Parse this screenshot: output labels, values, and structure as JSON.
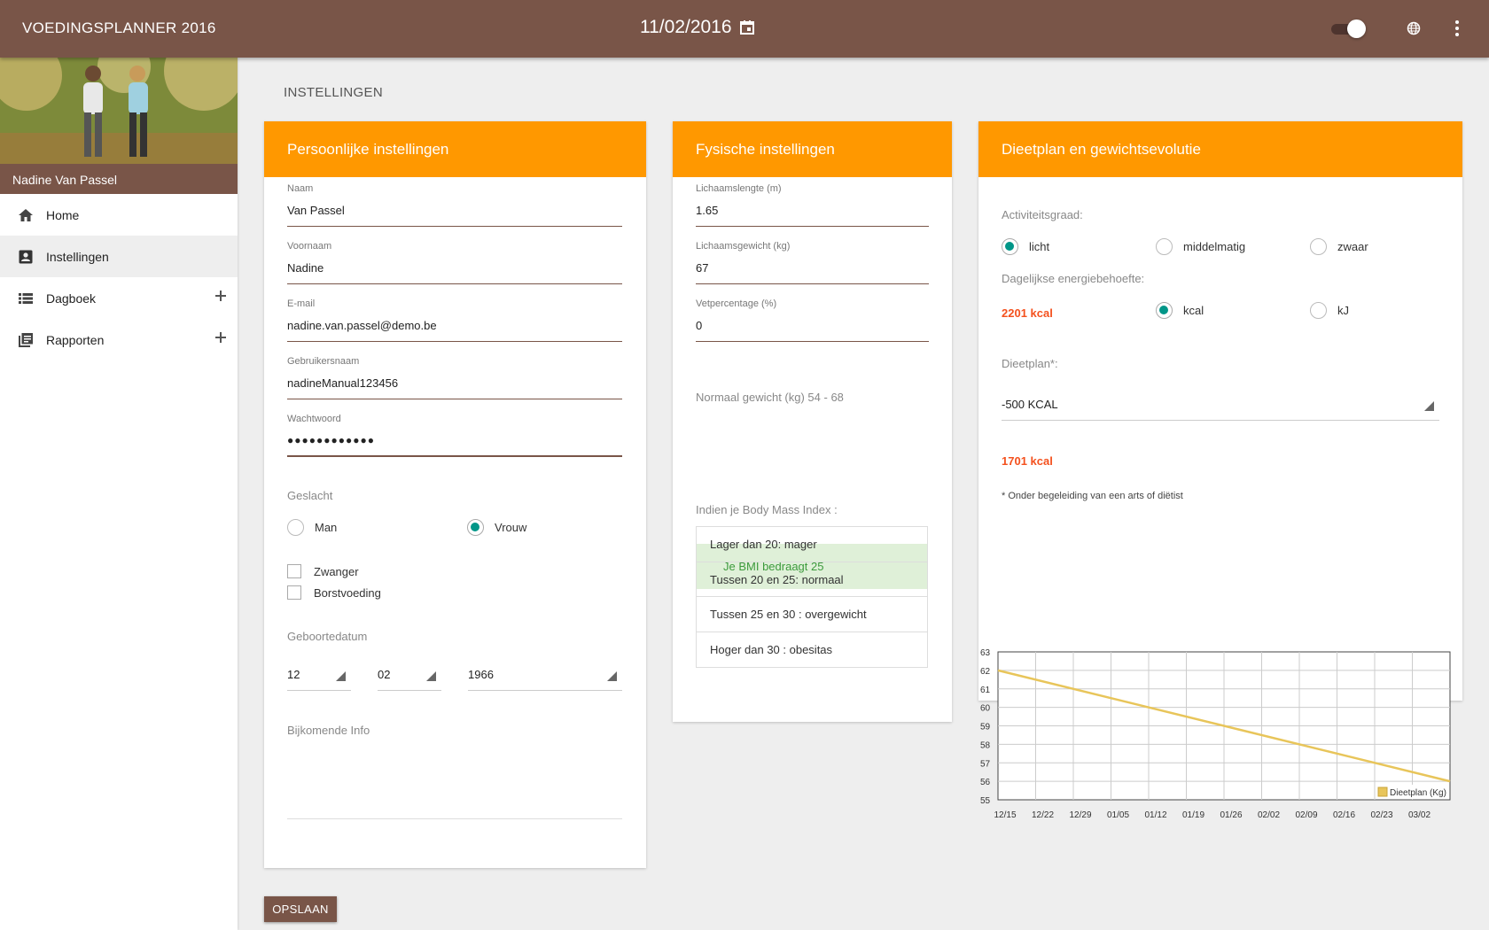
{
  "header": {
    "app_title": "VOEDINGSPLANNER 2016",
    "date": "11/02/2016"
  },
  "sidebar": {
    "profile_name": "Nadine Van Passel",
    "items": [
      {
        "label": "Home",
        "icon": "home-icon",
        "expandable": false
      },
      {
        "label": "Instellingen",
        "icon": "account-box-icon",
        "expandable": false,
        "active": true
      },
      {
        "label": "Dagboek",
        "icon": "list-icon",
        "expandable": true
      },
      {
        "label": "Rapporten",
        "icon": "library-books-icon",
        "expandable": true
      }
    ]
  },
  "page": {
    "title": "INSTELLINGEN",
    "save_label": "OPSLAAN"
  },
  "personal": {
    "title": "Persoonlijke instellingen",
    "fields": [
      {
        "label": "Naam",
        "value": "Van Passel"
      },
      {
        "label": "Voornaam",
        "value": "Nadine"
      },
      {
        "label": "E-mail",
        "value": "nadine.van.passel@demo.be"
      },
      {
        "label": "Gebruikersnaam",
        "value": "nadineManual123456"
      },
      {
        "label": "Wachtwoord",
        "value": "●●●●●●●●●●●●"
      }
    ],
    "gender_label": "Geslacht",
    "gender_options": [
      "Man",
      "Vrouw"
    ],
    "gender_selected": "Vrouw",
    "checkboxes": [
      "Zwanger",
      "Borstvoeding"
    ],
    "birthdate_label": "Geboortedatum",
    "birth_day": "12",
    "birth_month": "02",
    "birth_year": "1966",
    "extra_info_label": "Bijkomende Info"
  },
  "physical": {
    "title": "Fysische instellingen",
    "fields": [
      {
        "label": "Lichaamslengte (m)",
        "value": "1.65"
      },
      {
        "label": "Lichaamsgewicht (kg)",
        "value": "67"
      },
      {
        "label": "Vetpercentage (%)",
        "value": "0"
      }
    ],
    "normal_weight": "Normaal gewicht (kg) 54 - 68",
    "bmi_text": "Je BMI bedraagt 25",
    "bmi_intro": "Indien je Body Mass Index :",
    "bmi_ranges": [
      "Lager dan 20: mager",
      "Tussen 20 en 25: normaal",
      "Tussen 25 en 30 : overgewicht",
      "Hoger dan 30 : obesitas"
    ]
  },
  "diet": {
    "title": "Dieetplan en gewichtsevolutie",
    "activity_label": "Activiteitsgraad:",
    "activity_options": [
      "licht",
      "middelmatig",
      "zwaar"
    ],
    "activity_selected": "licht",
    "energy_label": "Dagelijkse energiebehoefte:",
    "energy_value": "2201 kcal",
    "unit_options": [
      "kcal",
      "kJ"
    ],
    "unit_selected": "kcal",
    "plan_label": "Dieetplan*:",
    "plan_value": "-500 KCAL",
    "plan_result": "1701 kcal",
    "footnote": "* Onder begeleiding van een arts of diëtist",
    "accent_color": "#ff9800",
    "highlight_color": "#f4511e"
  },
  "chart_data": {
    "type": "line",
    "categories": [
      "12/15",
      "12/22",
      "12/29",
      "01/05",
      "01/12",
      "01/19",
      "01/26",
      "02/02",
      "02/09",
      "02/16",
      "02/23",
      "03/02"
    ],
    "series": [
      {
        "name": "Dieetplan (Kg)",
        "color": "#e8c55a",
        "start": 62,
        "end": 56
      }
    ],
    "y_ticks": [
      55,
      56,
      57,
      58,
      59,
      60,
      61,
      62,
      63
    ],
    "ylim": [
      55,
      63
    ],
    "grid": true,
    "legend_position": "bottom-right"
  }
}
